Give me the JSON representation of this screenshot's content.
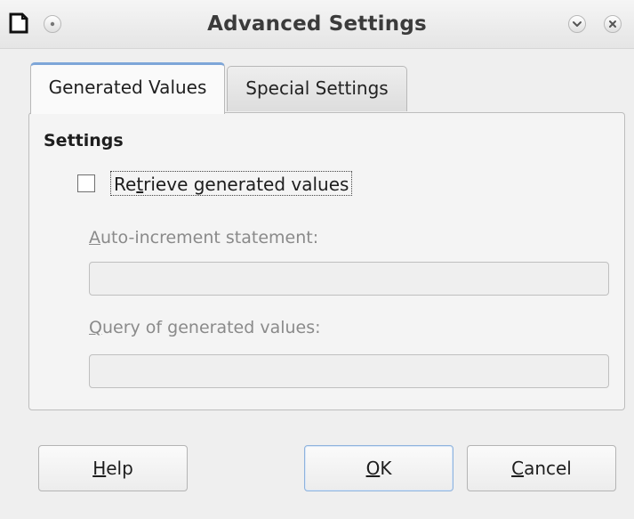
{
  "window": {
    "title": "Advanced Settings"
  },
  "tabs": [
    {
      "label": "Generated Values",
      "active": true
    },
    {
      "label": "Special Settings",
      "active": false
    }
  ],
  "settings": {
    "section_title": "Settings",
    "retrieve_generated_values": {
      "label_prefix": "Re",
      "label_mnemonic": "t",
      "label_suffix": "rieve generated values",
      "checked": false
    },
    "auto_increment_statement": {
      "label_mnemonic": "A",
      "label_suffix": "uto-increment statement:",
      "value": ""
    },
    "query_generated_values": {
      "label_mnemonic": "Q",
      "label_suffix": "uery of generated values:",
      "value": ""
    }
  },
  "buttons": {
    "help": {
      "mnemonic": "H",
      "suffix": "elp"
    },
    "ok": {
      "mnemonic": "O",
      "suffix": "K"
    },
    "cancel": {
      "mnemonic": "C",
      "suffix": "ancel"
    }
  },
  "icons": {
    "app": "document-icon",
    "menu": "window-menu-icon",
    "shade": "chevron-down-icon",
    "close": "close-icon"
  },
  "colors": {
    "window_bg": "#efefef",
    "tab_accent": "#7ea6d8",
    "button_focus": "#8fb3dd"
  }
}
